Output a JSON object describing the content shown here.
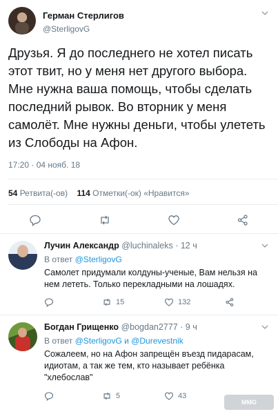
{
  "main_tweet": {
    "author_name": "Герман Стерлигов",
    "author_handle": "@SterligovG",
    "text": "Друзья. Я до последнего не хотел писать этот твит, но у меня нет другого выбора. Мне нужна ваша помощь, чтобы сделать последний рывок. Во вторник у меня самолёт. Мне нужны деньги, чтобы улететь из Слободы на Афон.",
    "timestamp": "17:20 · 04 нояб. 18",
    "retweets_count": "54",
    "retweets_label": "Ретвита(-ов)",
    "likes_count": "114",
    "likes_label": "Отметки(-ок) «Нравится»"
  },
  "replies": [
    {
      "author_name": "Лучин Александр",
      "author_handle": "@luchinaleks",
      "time": "· 12 ч",
      "in_reply_prefix": "В ответ",
      "in_reply_to": "@SterligovG",
      "text": "Самолет придумали колдуны-ученые, Вам нельзя на нем лететь. Только перекладными на лошадях.",
      "retweets": "15",
      "likes": "132"
    },
    {
      "author_name": "Богдан Грищенко",
      "author_handle": "@bogdan2777",
      "time": "· 9 ч",
      "in_reply_prefix": "В ответ",
      "in_reply_to": "@SterligovG и @Durevestnik",
      "text": "Сожалеем, но на Афон запрещён въезд пидарасам, идиотам, а так же тем, кто называет ребёнка \"хлебослав\"",
      "retweets": "5",
      "likes": "43"
    }
  ],
  "watermark": "MMG",
  "colors": {
    "link": "#1b95e0",
    "secondary": "#657786",
    "border": "#e6ecf0"
  }
}
